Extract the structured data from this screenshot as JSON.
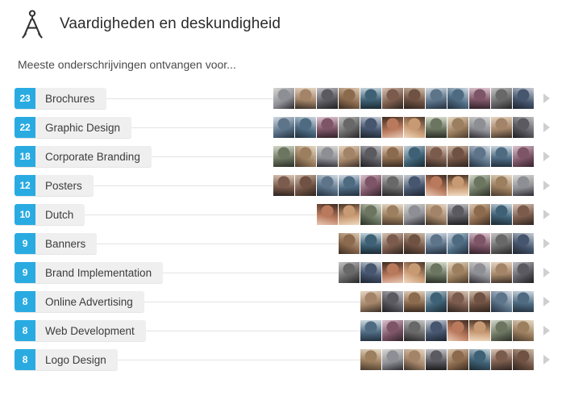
{
  "header": {
    "icon": "compass-divider-icon",
    "title": "Vaardigheden en deskundigheid"
  },
  "subtitle": "Meeste onderschrijvingen ontvangen voor...",
  "colors": {
    "badge_blue": "#29abe2",
    "pill_gray": "#efefef",
    "chevron_gray": "#cfcfcf",
    "connector_gray": "#e3e3e3",
    "title_text": "#2b2b2b"
  },
  "skills": [
    {
      "count": "23",
      "label": "Brochures",
      "endorsers": 23
    },
    {
      "count": "22",
      "label": "Graphic Design",
      "endorsers": 22
    },
    {
      "count": "18",
      "label": "Corporate Branding",
      "endorsers": 18
    },
    {
      "count": "12",
      "label": "Posters",
      "endorsers": 12
    },
    {
      "count": "10",
      "label": "Dutch",
      "endorsers": 10
    },
    {
      "count": "9",
      "label": "Banners",
      "endorsers": 9
    },
    {
      "count": "9",
      "label": "Brand Implementation",
      "endorsers": 9
    },
    {
      "count": "8",
      "label": "Online Advertising",
      "endorsers": 8
    },
    {
      "count": "8",
      "label": "Web Development",
      "endorsers": 8
    },
    {
      "count": "8",
      "label": "Logo Design",
      "endorsers": 8
    }
  ],
  "max_thumbs_per_row": 12,
  "expand_icon": "chevron-right-icon"
}
